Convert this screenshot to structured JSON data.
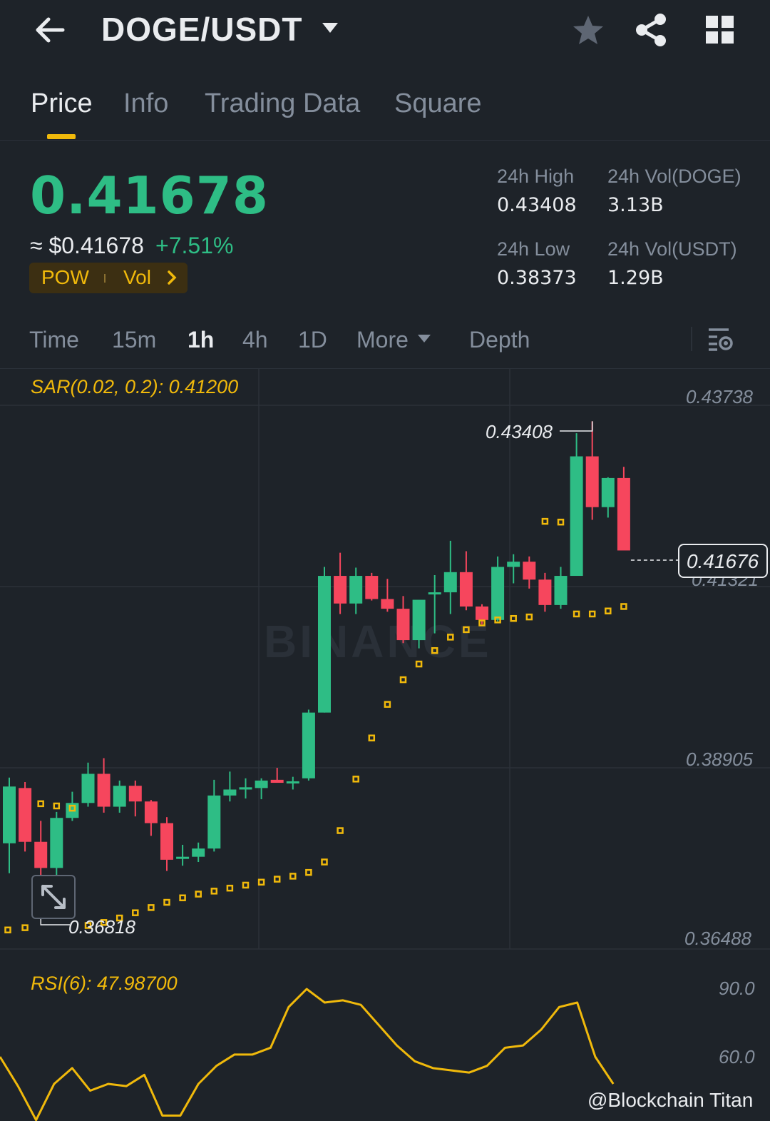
{
  "header": {
    "pair": "DOGE/USDT",
    "icons": [
      "back-arrow-icon",
      "caret-down-icon",
      "star-icon",
      "share-icon",
      "grid-icon"
    ]
  },
  "tabs": [
    {
      "label": "Price",
      "active": true
    },
    {
      "label": "Info",
      "active": false
    },
    {
      "label": "Trading Data",
      "active": false
    },
    {
      "label": "Square",
      "active": false
    }
  ],
  "ticker": {
    "last_price": "0.41678",
    "approx_usd": "≈ $0.41678",
    "change": "+7.51%",
    "tag_1": "POW",
    "tag_2": "Vol",
    "high_label": "24h High",
    "high_value": "0.43408",
    "low_label": "24h Low",
    "low_value": "0.38373",
    "vol_base_label": "24h Vol(DOGE)",
    "vol_base_value": "3.13B",
    "vol_quote_label": "24h Vol(USDT)",
    "vol_quote_value": "1.29B"
  },
  "intervals": [
    {
      "label": "Time",
      "active": false
    },
    {
      "label": "15m",
      "active": false
    },
    {
      "label": "1h",
      "active": true
    },
    {
      "label": "4h",
      "active": false
    },
    {
      "label": "1D",
      "active": false
    },
    {
      "label": "More",
      "active": false
    },
    {
      "label": "Depth",
      "active": false
    }
  ],
  "colors": {
    "up": "#2ebd85",
    "down": "#f6465d",
    "accent": "#f0b90b",
    "bg": "#1e2329",
    "muted": "#848e9c"
  },
  "chart_data": {
    "type": "candlestick",
    "indicator": "SAR(0.02, 0.2): 0.41200",
    "y_axis_labels": [
      "0.43738",
      "0.41321",
      "0.38905",
      "0.36488"
    ],
    "high_marker": "0.43408",
    "low_marker": "0.36818",
    "current_price": "0.41676",
    "watermark": "BINANCE",
    "candles": [
      {
        "o": 0.3776,
        "h": 0.3864,
        "l": 0.3736,
        "c": 0.3852
      },
      {
        "o": 0.385,
        "h": 0.3858,
        "l": 0.3765,
        "c": 0.3778
      },
      {
        "o": 0.3778,
        "h": 0.3806,
        "l": 0.3723,
        "c": 0.3743
      },
      {
        "o": 0.3743,
        "h": 0.3818,
        "l": 0.3704,
        "c": 0.381
      },
      {
        "o": 0.381,
        "h": 0.3845,
        "l": 0.3806,
        "c": 0.383
      },
      {
        "o": 0.383,
        "h": 0.3884,
        "l": 0.3825,
        "c": 0.3869
      },
      {
        "o": 0.3869,
        "h": 0.389,
        "l": 0.3817,
        "c": 0.3825
      },
      {
        "o": 0.3825,
        "h": 0.386,
        "l": 0.3817,
        "c": 0.3853
      },
      {
        "o": 0.3853,
        "h": 0.386,
        "l": 0.3812,
        "c": 0.3832
      },
      {
        "o": 0.3832,
        "h": 0.3834,
        "l": 0.3786,
        "c": 0.3803
      },
      {
        "o": 0.3803,
        "h": 0.3811,
        "l": 0.3739,
        "c": 0.3754
      },
      {
        "o": 0.3756,
        "h": 0.3774,
        "l": 0.3746,
        "c": 0.3758
      },
      {
        "o": 0.3758,
        "h": 0.3777,
        "l": 0.3751,
        "c": 0.3769
      },
      {
        "o": 0.3769,
        "h": 0.3861,
        "l": 0.3765,
        "c": 0.384
      },
      {
        "o": 0.384,
        "h": 0.3872,
        "l": 0.3832,
        "c": 0.3848
      },
      {
        "o": 0.3848,
        "h": 0.3863,
        "l": 0.3836,
        "c": 0.3851
      },
      {
        "o": 0.385,
        "h": 0.3863,
        "l": 0.3835,
        "c": 0.386
      },
      {
        "o": 0.3861,
        "h": 0.3877,
        "l": 0.3858,
        "c": 0.3857
      },
      {
        "o": 0.3857,
        "h": 0.3865,
        "l": 0.3848,
        "c": 0.3859
      },
      {
        "o": 0.3863,
        "h": 0.3955,
        "l": 0.386,
        "c": 0.3951
      },
      {
        "o": 0.3951,
        "h": 0.4146,
        "l": 0.3951,
        "c": 0.4134
      },
      {
        "o": 0.4134,
        "h": 0.4165,
        "l": 0.4083,
        "c": 0.4097
      },
      {
        "o": 0.4097,
        "h": 0.4145,
        "l": 0.4083,
        "c": 0.4134
      },
      {
        "o": 0.4134,
        "h": 0.4138,
        "l": 0.4101,
        "c": 0.4103
      },
      {
        "o": 0.4103,
        "h": 0.413,
        "l": 0.4086,
        "c": 0.409
      },
      {
        "o": 0.409,
        "h": 0.4107,
        "l": 0.4044,
        "c": 0.4048
      },
      {
        "o": 0.4048,
        "h": 0.4101,
        "l": 0.4037,
        "c": 0.4102
      },
      {
        "o": 0.4112,
        "h": 0.4135,
        "l": 0.4057,
        "c": 0.4112
      },
      {
        "o": 0.4112,
        "h": 0.4181,
        "l": 0.4083,
        "c": 0.4139
      },
      {
        "o": 0.4139,
        "h": 0.4167,
        "l": 0.4088,
        "c": 0.4093
      },
      {
        "o": 0.4093,
        "h": 0.4096,
        "l": 0.4069,
        "c": 0.4075
      },
      {
        "o": 0.4075,
        "h": 0.416,
        "l": 0.4073,
        "c": 0.4146
      },
      {
        "o": 0.4146,
        "h": 0.4163,
        "l": 0.4124,
        "c": 0.4153
      },
      {
        "o": 0.4153,
        "h": 0.416,
        "l": 0.4117,
        "c": 0.4129
      },
      {
        "o": 0.4129,
        "h": 0.4138,
        "l": 0.4086,
        "c": 0.4095
      },
      {
        "o": 0.4095,
        "h": 0.4146,
        "l": 0.409,
        "c": 0.4134
      },
      {
        "o": 0.4134,
        "h": 0.4325,
        "l": 0.4134,
        "c": 0.4294
      },
      {
        "o": 0.4294,
        "h": 0.4341,
        "l": 0.4209,
        "c": 0.4226
      },
      {
        "o": 0.4226,
        "h": 0.4266,
        "l": 0.4212,
        "c": 0.4265
      },
      {
        "o": 0.4265,
        "h": 0.428,
        "l": 0.4174,
        "c": 0.4168
      }
    ],
    "sar": [
      {
        "i": 0,
        "v": 0.366
      },
      {
        "i": 1,
        "v": 0.3663
      },
      {
        "i": 2,
        "v": 0.3829
      },
      {
        "i": 3,
        "v": 0.3826
      },
      {
        "i": 4,
        "v": 0.3823
      },
      {
        "i": 5,
        "v": 0.3666
      },
      {
        "i": 6,
        "v": 0.367
      },
      {
        "i": 7,
        "v": 0.3676
      },
      {
        "i": 8,
        "v": 0.3683
      },
      {
        "i": 9,
        "v": 0.369
      },
      {
        "i": 10,
        "v": 0.3697
      },
      {
        "i": 11,
        "v": 0.3703
      },
      {
        "i": 12,
        "v": 0.3708
      },
      {
        "i": 13,
        "v": 0.3712
      },
      {
        "i": 14,
        "v": 0.3716
      },
      {
        "i": 15,
        "v": 0.372
      },
      {
        "i": 16,
        "v": 0.3724
      },
      {
        "i": 17,
        "v": 0.3728
      },
      {
        "i": 18,
        "v": 0.3732
      },
      {
        "i": 19,
        "v": 0.3737
      },
      {
        "i": 20,
        "v": 0.3751
      },
      {
        "i": 21,
        "v": 0.3793
      },
      {
        "i": 22,
        "v": 0.3862
      },
      {
        "i": 23,
        "v": 0.3917
      },
      {
        "i": 24,
        "v": 0.3962
      },
      {
        "i": 25,
        "v": 0.3995
      },
      {
        "i": 26,
        "v": 0.4016
      },
      {
        "i": 27,
        "v": 0.4034
      },
      {
        "i": 28,
        "v": 0.4052
      },
      {
        "i": 29,
        "v": 0.4062
      },
      {
        "i": 30,
        "v": 0.4071
      },
      {
        "i": 31,
        "v": 0.4075
      },
      {
        "i": 32,
        "v": 0.4077
      },
      {
        "i": 33,
        "v": 0.4079
      },
      {
        "i": 34,
        "v": 0.4207
      },
      {
        "i": 35,
        "v": 0.4206
      },
      {
        "i": 36,
        "v": 0.4083
      },
      {
        "i": 37,
        "v": 0.4083
      },
      {
        "i": 38,
        "v": 0.4087
      },
      {
        "i": 39,
        "v": 0.4093
      }
    ],
    "rsi": {
      "label": "RSI(6): 47.98700",
      "axis_labels": [
        "90.0",
        "60.0"
      ],
      "values": [
        60,
        47,
        32,
        48,
        55,
        45,
        48,
        47,
        52,
        34,
        34,
        48,
        56,
        61,
        61,
        64,
        82,
        90,
        84,
        85,
        83,
        74,
        65,
        58,
        55,
        54,
        53,
        56,
        64,
        65,
        72,
        82,
        84,
        60,
        48
      ]
    }
  },
  "credit": "@Blockchain Titan"
}
